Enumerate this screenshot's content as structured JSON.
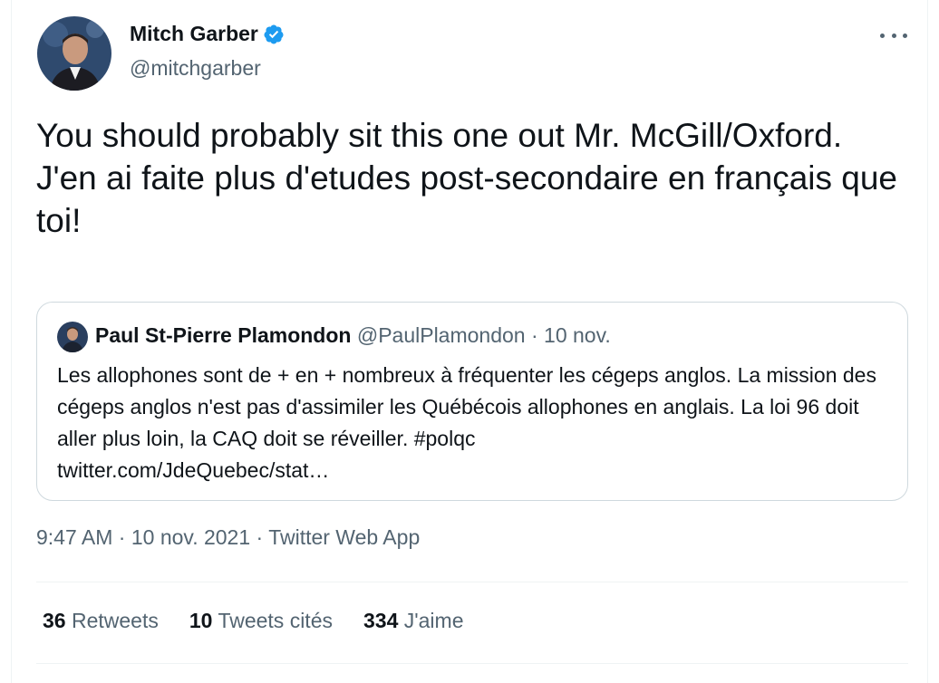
{
  "author": {
    "name": "Mitch Garber",
    "handle": "@mitchgarber",
    "verified": true
  },
  "tweet": {
    "text": "You should probably sit this one out Mr. McGill/Oxford.\nJ'en ai faite plus d'etudes post-secondaire en français que toi!"
  },
  "quoted": {
    "name": "Paul St-Pierre Plamondon",
    "handle": "@PaulPlamondon",
    "separator": "·",
    "date": "10 nov.",
    "text": "Les allophones sont de + en + nombreux à fréquenter les cégeps anglos. La mission des cégeps anglos n'est pas d'assimiler les Québécois allophones en anglais. La loi 96 doit aller plus loin, la CAQ doit se réveiller. #polqc",
    "link": "twitter.com/JdeQuebec/stat…"
  },
  "meta": {
    "time": "9:47 AM",
    "sep1": "·",
    "date": "10 nov. 2021",
    "sep2": "·",
    "source": "Twitter Web App"
  },
  "stats": {
    "retweets": {
      "count": "36",
      "label": "Retweets"
    },
    "quotes": {
      "count": "10",
      "label": "Tweets cités"
    },
    "likes": {
      "count": "334",
      "label": "J'aime"
    }
  },
  "colors": {
    "text": "#0f1419",
    "secondary": "#536471",
    "verified": "#1d9bf0",
    "border": "#cfd9de",
    "divider": "#eff3f4"
  },
  "icons": {
    "verified": "verified-badge-icon",
    "more": "more-options-icon"
  }
}
